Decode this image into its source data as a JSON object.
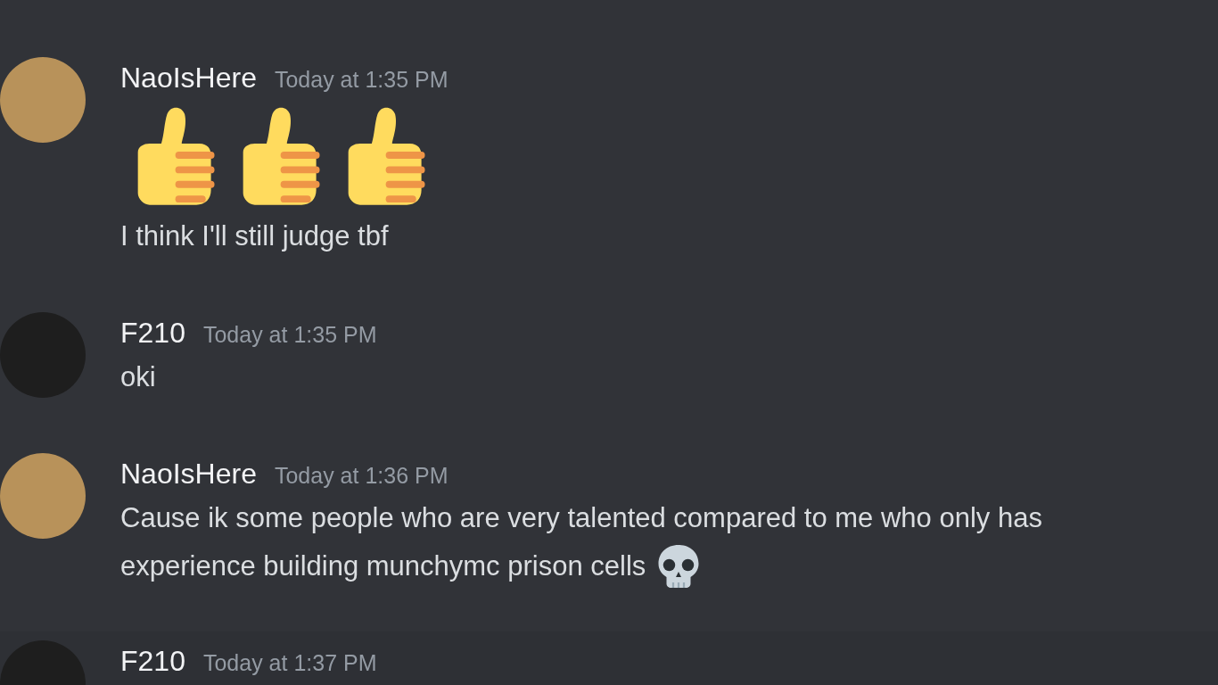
{
  "messages": [
    {
      "author": "NaoIsHere",
      "time": "Today at 1:35 PM",
      "highlighted": false,
      "lines": [
        {
          "kind": "emoji",
          "emojis": [
            {
              "kind": "thumbs-up"
            },
            {
              "kind": "thumbs-up"
            },
            {
              "kind": "thumbs-up"
            }
          ]
        },
        {
          "kind": "text",
          "text": "I think I'll still judge tbf"
        }
      ]
    },
    {
      "author": "F210",
      "time": "Today at 1:35 PM",
      "highlighted": false,
      "lines": [
        {
          "kind": "text",
          "text": "oki"
        }
      ]
    },
    {
      "author": "NaoIsHere",
      "time": "Today at 1:36 PM",
      "highlighted": false,
      "lines": [
        {
          "kind": "text",
          "text": "Cause ik some people who are very talented compared to me who only has"
        },
        {
          "kind": "text",
          "text": "experience building munchymc prison cells",
          "emojis": [
            {
              "kind": "skull"
            }
          ]
        }
      ]
    },
    {
      "author": "F210",
      "time": "Today at 1:37 PM",
      "highlighted": true
    }
  ]
}
